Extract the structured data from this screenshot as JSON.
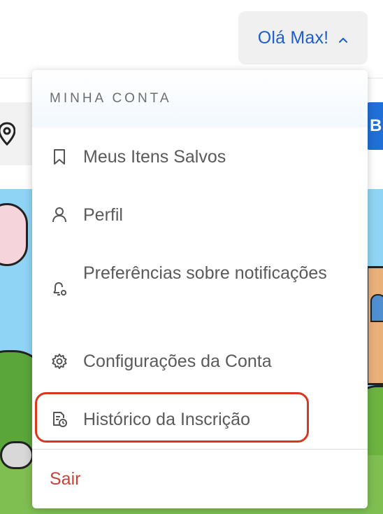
{
  "header": {
    "greeting": "Olá Max!",
    "greeting_icon": "chevron-up-icon",
    "accent_color": "#1f5ec9"
  },
  "background": {
    "search_button_label": "B",
    "location_icon": "map-pin-icon"
  },
  "menu": {
    "section_title": "MINHA CONTA",
    "items": [
      {
        "label": "Meus Itens Salvos",
        "icon": "bookmark-icon"
      },
      {
        "label": "Perfil",
        "icon": "user-icon"
      },
      {
        "label": "Preferências sobre notificações",
        "icon": "bell-settings-icon"
      },
      {
        "label": "Configurações da Conta",
        "icon": "gear-icon"
      },
      {
        "label": "Histórico da Inscrição",
        "icon": "document-clock-icon",
        "highlighted": true
      }
    ],
    "logout_label": "Sair",
    "logout_color": "#c8433a",
    "highlight_color": "#d9381e"
  }
}
